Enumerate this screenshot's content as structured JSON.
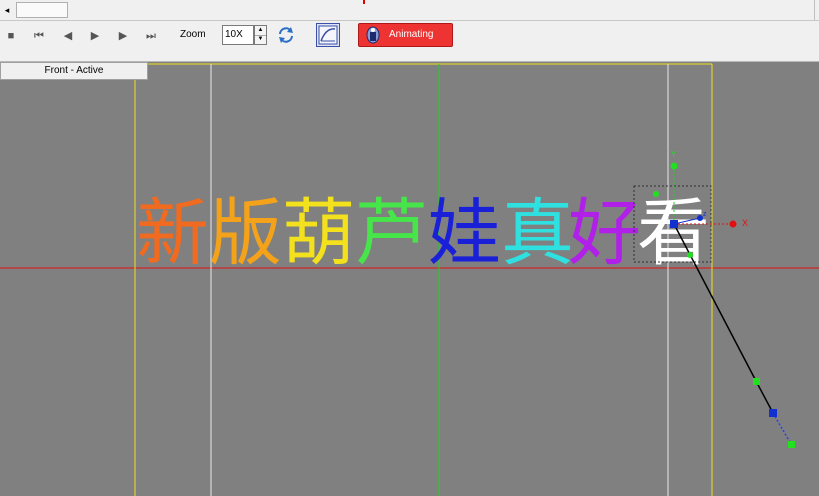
{
  "scrollbar": {
    "left_arrow": "◂"
  },
  "transport": {
    "stop": "■",
    "rewind": "⏮",
    "step_back": "◀",
    "play": "▶",
    "step_forward": "▶",
    "end": "⏭"
  },
  "zoom": {
    "label": "Zoom",
    "value": "10X"
  },
  "animate_button": {
    "label": "Animating",
    "color": "#ee3333"
  },
  "viewport": {
    "tab_label": "Front - Active",
    "title_text": "新版葫芦娃真好看",
    "glyphs": [
      {
        "char": "新",
        "color": "#f06a20"
      },
      {
        "char": "版",
        "color": "#f3a21a"
      },
      {
        "char": "葫",
        "color": "#f2e11c"
      },
      {
        "char": "芦",
        "color": "#46e64a"
      },
      {
        "char": "娃",
        "color": "#1a20d8"
      },
      {
        "char": "真",
        "color": "#2fe0e0"
      },
      {
        "char": "好",
        "color": "#b020e8"
      },
      {
        "char": "看",
        "color": "#ffffff"
      }
    ],
    "gizmo": {
      "y_label": "Y",
      "x_label": "X",
      "z_label": "z"
    }
  }
}
